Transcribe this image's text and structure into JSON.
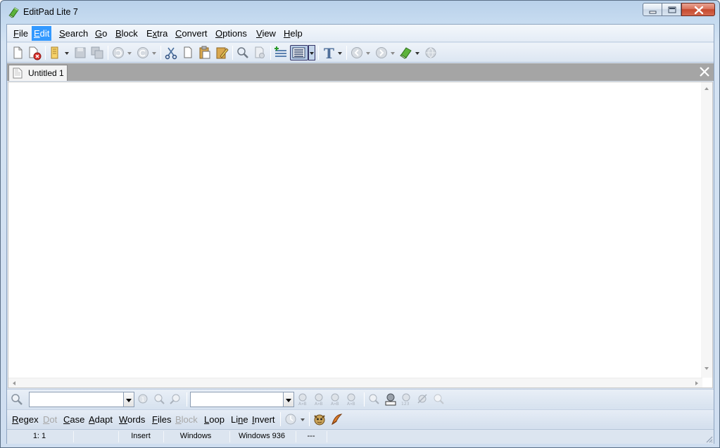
{
  "window": {
    "title": "EditPad Lite 7",
    "icon": "green-eraser-app-icon",
    "controls": {
      "minimize": "minimize-icon",
      "maximize": "maximize-icon",
      "close": "close-icon"
    }
  },
  "menubar": {
    "items": [
      {
        "pre": "",
        "key": "F",
        "post": "ile"
      },
      {
        "pre": "",
        "key": "E",
        "post": "dit",
        "active": true
      },
      {
        "pre": "",
        "key": "S",
        "post": "earch"
      },
      {
        "pre": "",
        "key": "G",
        "post": "o"
      },
      {
        "pre": "",
        "key": "B",
        "post": "lock"
      },
      {
        "pre": "E",
        "key": "x",
        "post": "tra"
      },
      {
        "pre": "",
        "key": "C",
        "post": "onvert"
      },
      {
        "pre": "",
        "key": "O",
        "post": "ptions"
      },
      {
        "pre": "",
        "key": "V",
        "post": "iew"
      },
      {
        "pre": "",
        "key": "H",
        "post": "elp"
      }
    ]
  },
  "toolbar": {
    "icons": [
      "new-file-icon",
      "close-file-icon",
      "open-file-icon",
      "save-icon",
      "save-all-icon",
      "undo-icon",
      "redo-icon",
      "cut-icon",
      "copy-icon",
      "paste-icon",
      "clipboard-edit-icon",
      "find-icon",
      "print-icon",
      "insert-line-icon",
      "word-wrap-icon",
      "font-icon",
      "back-icon",
      "forward-icon",
      "eraser-icon",
      "web-icon"
    ]
  },
  "tabs": [
    {
      "label": "Untitled 1"
    }
  ],
  "searchbar": {
    "search_value": "",
    "replace_value": ""
  },
  "options": {
    "items": [
      {
        "pre": "",
        "key": "R",
        "post": "egex",
        "enabled": true
      },
      {
        "pre": "",
        "key": "D",
        "post": "ot",
        "enabled": false
      },
      {
        "pre": "",
        "key": "C",
        "post": "ase",
        "enabled": true
      },
      {
        "pre": "",
        "key": "A",
        "post": "dapt",
        "enabled": true
      },
      {
        "pre": "",
        "key": "W",
        "post": "ords",
        "enabled": true
      },
      {
        "pre": "",
        "key": "F",
        "post": "iles",
        "enabled": true
      },
      {
        "pre": "",
        "key": "B",
        "post": "lock",
        "enabled": false
      },
      {
        "pre": "",
        "key": "L",
        "post": "oop",
        "enabled": true
      },
      {
        "pre": "Li",
        "key": "n",
        "post": "e",
        "enabled": true
      },
      {
        "pre": "",
        "key": "I",
        "post": "nvert",
        "enabled": true
      }
    ]
  },
  "statusbar": {
    "position": "1: 1",
    "blank1": "",
    "mode": "Insert",
    "line_breaks": "Windows",
    "encoding": "Windows 936",
    "extra": "---"
  }
}
